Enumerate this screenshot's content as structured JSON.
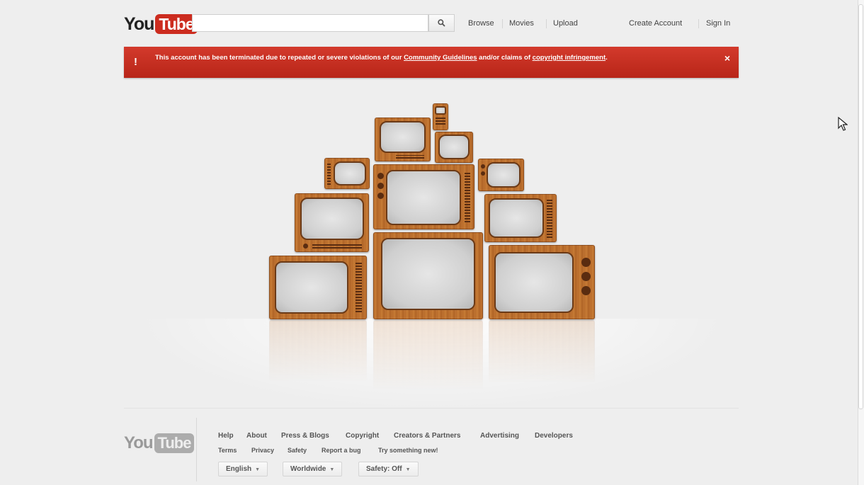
{
  "header": {
    "logo_you": "You",
    "logo_tube": "Tube",
    "search_placeholder": "",
    "nav": [
      "Browse",
      "Movies",
      "Upload"
    ],
    "create_account": "Create Account",
    "sign_in": "Sign In"
  },
  "alert": {
    "icon": "!",
    "text_pre": "This account has been terminated due to repeated or severe violations of our ",
    "link_guidelines": "Community Guidelines",
    "text_mid": " and/or claims of ",
    "link_copyright": "copyright infringement",
    "text_post": ".",
    "close": "×"
  },
  "footer": {
    "logo_you": "You",
    "logo_tube": "Tube",
    "row1": [
      "Help",
      "About",
      "Press & Blogs",
      "Copyright",
      "Creators & Partners",
      "Advertising",
      "Developers"
    ],
    "row2": [
      "Terms",
      "Privacy",
      "Safety",
      "Report a bug",
      "Try something new!"
    ],
    "language": "English",
    "location": "Worldwide",
    "safety": "Safety: Off"
  },
  "colors": {
    "brand_red": "#cc2c1f",
    "alert_red": "#c42f22",
    "wood": "#b76a2a"
  },
  "icons": {
    "search": "search-icon",
    "alert": "exclamation-icon",
    "close": "close-icon",
    "caret": "caret-down-icon",
    "cursor": "mouse-cursor-icon"
  }
}
